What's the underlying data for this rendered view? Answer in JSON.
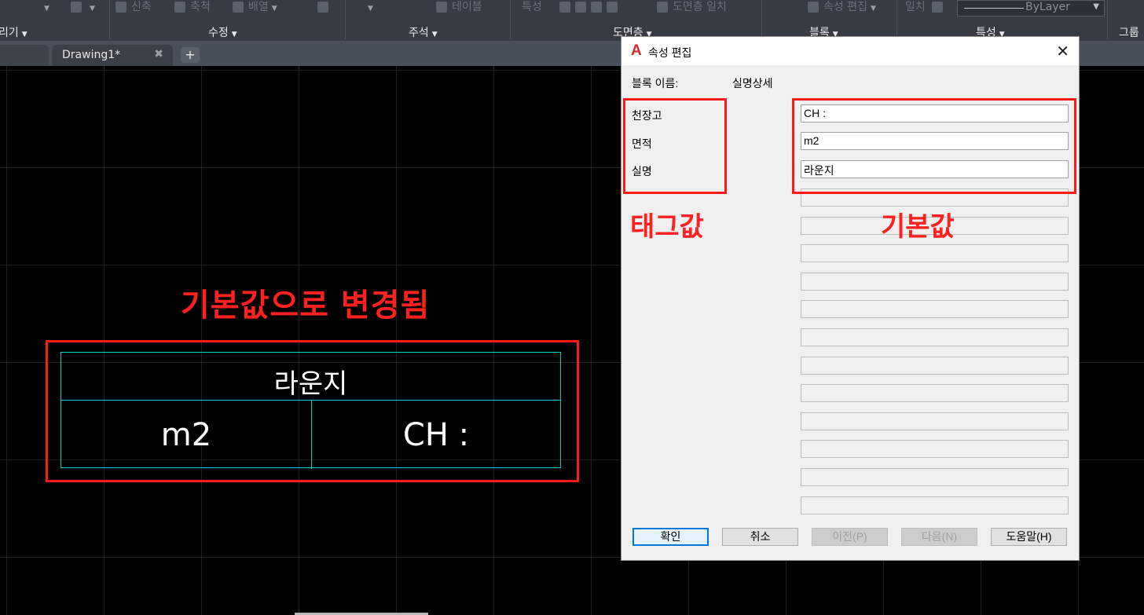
{
  "ribbon": {
    "top_items": [
      "신축",
      "축척",
      "배열",
      "테이블",
      "특성",
      "도면층 일치",
      "속성 편집",
      "일치"
    ],
    "panels": [
      "리기",
      "수정",
      "주석",
      "도면층",
      "블록",
      "특성",
      "그룹"
    ],
    "linetype_value": "ByLayer"
  },
  "tabs": {
    "active_label": "Drawing1*",
    "close_glyph": "✖",
    "add_glyph": "+"
  },
  "canvas": {
    "annotation": "기본값으로 변경됨",
    "block": {
      "top": "라운지",
      "bottom_left": "m2",
      "bottom_right": "CH :"
    }
  },
  "dialog": {
    "logo": "A",
    "title": "속성 편집",
    "close_glyph": "✕",
    "block_name_label": "블록 이름:",
    "block_name_value": "실명상세",
    "tags": [
      "천장고",
      "면적",
      "실명"
    ],
    "values": [
      "CH :",
      "m2",
      "라운지"
    ],
    "empty_field_count": 12,
    "annotation_tags": "태그값",
    "annotation_values": "기본값",
    "buttons": {
      "ok": "확인",
      "cancel": "취소",
      "prev": "이전(P)",
      "next": "다음(N)",
      "help": "도움말(H)"
    }
  },
  "colors": {
    "annotation_red": "#ff1a1a",
    "block_lines": "#00d0c8",
    "ribbon_bg": "#363b44",
    "canvas_bg": "#000000"
  }
}
